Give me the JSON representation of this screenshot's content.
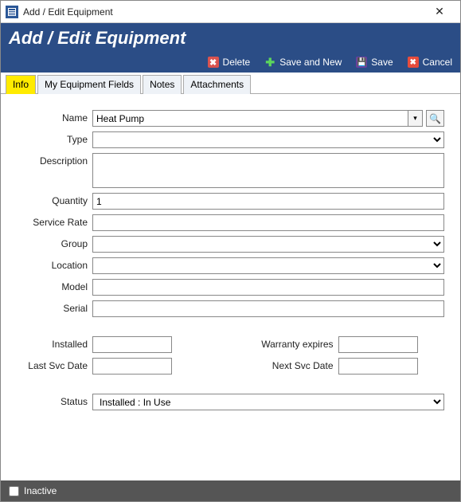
{
  "window": {
    "title": "Add / Edit Equipment"
  },
  "header": {
    "title": "Add / Edit Equipment"
  },
  "toolbar": {
    "delete": "Delete",
    "save_and_new": "Save and New",
    "save": "Save",
    "cancel": "Cancel"
  },
  "tabs": [
    "Info",
    "My Equipment Fields",
    "Notes",
    "Attachments"
  ],
  "fields": {
    "name": {
      "label": "Name",
      "value": "Heat Pump"
    },
    "type": {
      "label": "Type",
      "value": ""
    },
    "description": {
      "label": "Description",
      "value": ""
    },
    "quantity": {
      "label": "Quantity",
      "value": "1"
    },
    "service_rate": {
      "label": "Service Rate",
      "value": ""
    },
    "group": {
      "label": "Group",
      "value": ""
    },
    "location": {
      "label": "Location",
      "value": ""
    },
    "model": {
      "label": "Model",
      "value": ""
    },
    "serial": {
      "label": "Serial",
      "value": ""
    },
    "installed": {
      "label": "Installed",
      "value": ""
    },
    "warranty_expires": {
      "label": "Warranty expires",
      "value": ""
    },
    "last_svc_date": {
      "label": "Last Svc Date",
      "value": ""
    },
    "next_svc_date": {
      "label": "Next Svc Date",
      "value": ""
    },
    "status": {
      "label": "Status",
      "value": "Installed : In Use"
    }
  },
  "footer": {
    "inactive": "Inactive"
  }
}
